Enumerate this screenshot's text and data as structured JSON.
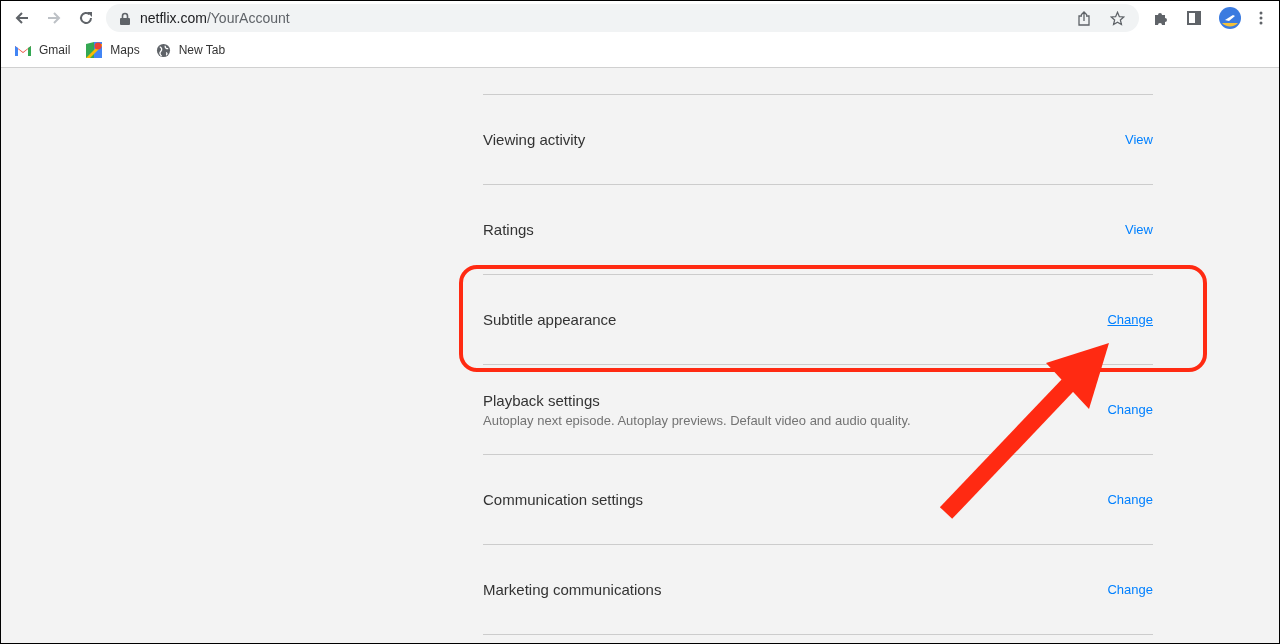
{
  "browser": {
    "url_domain": "netflix.com",
    "url_path": "/YourAccount",
    "forward_disabled": true,
    "bookmarks": [
      {
        "kind": "gmail",
        "label": "Gmail"
      },
      {
        "kind": "maps",
        "label": "Maps"
      },
      {
        "kind": "globe",
        "label": "New Tab"
      }
    ]
  },
  "settings": [
    {
      "label": "Viewing activity",
      "action": "View",
      "highlighted": false
    },
    {
      "label": "Ratings",
      "action": "View",
      "highlighted": false
    },
    {
      "label": "Subtitle appearance",
      "action": "Change",
      "highlighted": true
    },
    {
      "label": "Playback settings",
      "description": "Autoplay next episode. Autoplay previews. Default video and audio quality.",
      "action": "Change",
      "highlighted": false
    },
    {
      "label": "Communication settings",
      "action": "Change",
      "highlighted": false
    },
    {
      "label": "Marketing communications",
      "action": "Change",
      "highlighted": false
    }
  ]
}
